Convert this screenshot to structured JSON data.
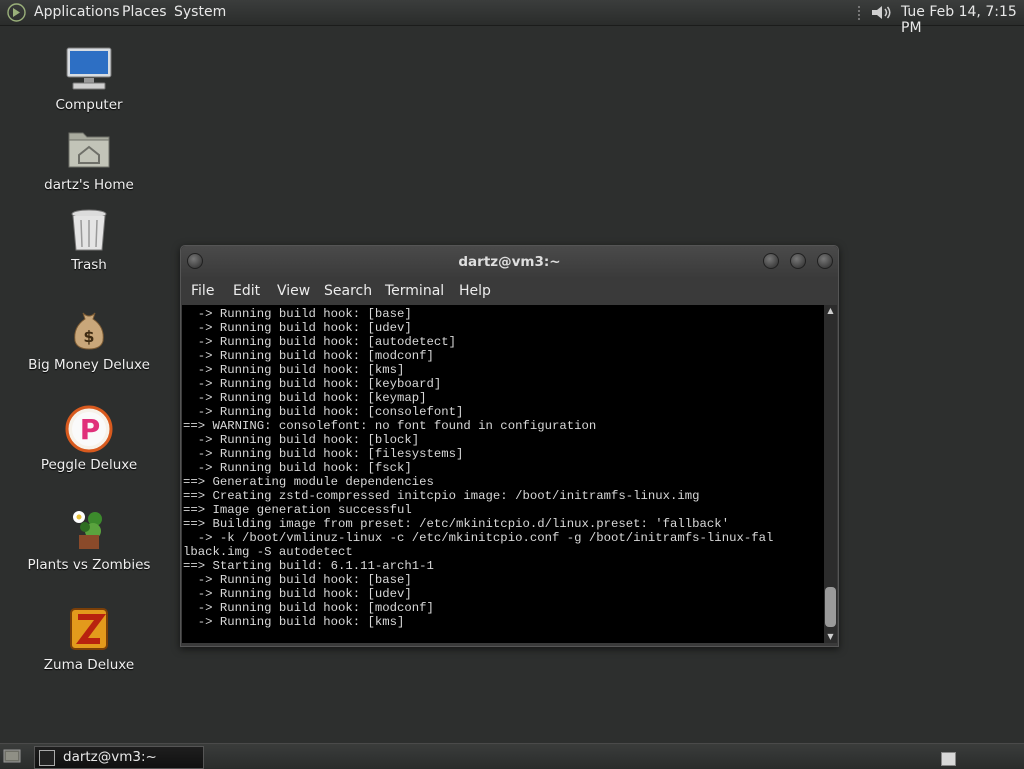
{
  "top_panel": {
    "menus": [
      "Applications",
      "Places",
      "System"
    ],
    "clock": "Tue Feb 14,  7:15 PM"
  },
  "desktop_icons": [
    {
      "label": "Computer",
      "icon": "computer-icon"
    },
    {
      "label": "dartz's Home",
      "icon": "home-folder-icon"
    },
    {
      "label": "Trash",
      "icon": "trash-icon"
    },
    {
      "label": "Big Money Deluxe",
      "icon": "money-bag-icon"
    },
    {
      "label": "Peggle Deluxe",
      "icon": "peggle-icon"
    },
    {
      "label": "Plants vs Zombies",
      "icon": "plants-vs-zombies-icon"
    },
    {
      "label": "Zuma Deluxe",
      "icon": "zuma-icon"
    }
  ],
  "terminal": {
    "title": "dartz@vm3:~",
    "menu": [
      "File",
      "Edit",
      "View",
      "Search",
      "Terminal",
      "Help"
    ],
    "lines": [
      "  -> Running build hook: [base]",
      "  -> Running build hook: [udev]",
      "  -> Running build hook: [autodetect]",
      "  -> Running build hook: [modconf]",
      "  -> Running build hook: [kms]",
      "  -> Running build hook: [keyboard]",
      "  -> Running build hook: [keymap]",
      "  -> Running build hook: [consolefont]",
      "==> WARNING: consolefont: no font found in configuration",
      "  -> Running build hook: [block]",
      "  -> Running build hook: [filesystems]",
      "  -> Running build hook: [fsck]",
      "==> Generating module dependencies",
      "==> Creating zstd-compressed initcpio image: /boot/initramfs-linux.img",
      "==> Image generation successful",
      "==> Building image from preset: /etc/mkinitcpio.d/linux.preset: 'fallback'",
      "  -> -k /boot/vmlinuz-linux -c /etc/mkinitcpio.conf -g /boot/initramfs-linux-fal",
      "lback.img -S autodetect",
      "==> Starting build: 6.1.11-arch1-1",
      "  -> Running build hook: [base]",
      "  -> Running build hook: [udev]",
      "  -> Running build hook: [modconf]",
      "  -> Running build hook: [kms]"
    ]
  },
  "taskbar": {
    "window_label": "dartz@vm3:~"
  },
  "colors": {
    "desktop_bg": "#2d2f2e",
    "terminal_bg": "#000000",
    "terminal_fg": "#d8d8d8"
  }
}
